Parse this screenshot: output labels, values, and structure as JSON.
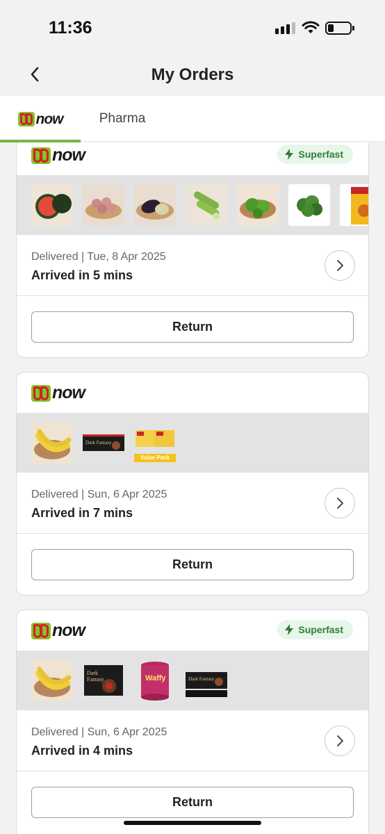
{
  "status_bar": {
    "time": "11:36"
  },
  "header": {
    "title": "My Orders",
    "back_icon": "chevron-left-icon"
  },
  "tabs": [
    {
      "label": "now",
      "active": true
    },
    {
      "label": "Pharma",
      "active": false
    }
  ],
  "colors": {
    "accent_green": "#7cb342",
    "brand_green": "#84c225",
    "brand_red": "#d32027",
    "superfast_bg": "#e8f5e9",
    "superfast_text": "#2e7d32"
  },
  "orders": [
    {
      "brand": "now",
      "badge": "Superfast",
      "products": [
        "watermelon",
        "onions",
        "brinjal",
        "cucumber",
        "capsicum",
        "coriander",
        "masala-pack"
      ],
      "status": "Delivered | Tue, 8 Apr 2025",
      "arrived": "Arrived in 5 mins",
      "return_label": "Return"
    },
    {
      "brand": "now",
      "badge": "",
      "products": [
        "banana",
        "dark-fantasy-biscuits",
        "snack-pack"
      ],
      "product_tag": "Value Pack",
      "status": "Delivered | Sun, 6 Apr 2025",
      "arrived": "Arrived in 7 mins",
      "return_label": "Return"
    },
    {
      "brand": "now",
      "badge": "Superfast",
      "products": [
        "banana",
        "dark-fantasy-box",
        "waffy-tin",
        "dark-fantasy-biscuits"
      ],
      "status": "Delivered | Sun, 6 Apr 2025",
      "arrived": "Arrived in 4 mins",
      "return_label": "Return"
    }
  ]
}
